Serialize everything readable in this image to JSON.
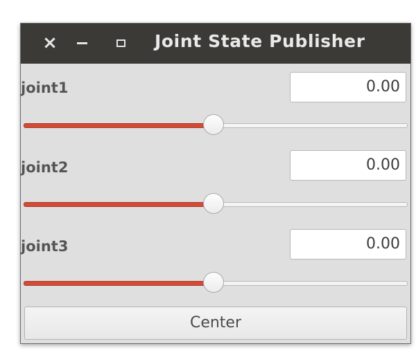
{
  "window": {
    "title": "Joint State Publisher",
    "buttons": {
      "close": "×",
      "minimize": "minimize",
      "maximize": "maximize"
    }
  },
  "joints": [
    {
      "name": "joint1",
      "value": "0.00",
      "slider_position": 0.5
    },
    {
      "name": "joint2",
      "value": "0.00",
      "slider_position": 0.5
    },
    {
      "name": "joint3",
      "value": "0.00",
      "slider_position": 0.5
    }
  ],
  "center_button": {
    "label": "Center"
  },
  "colors": {
    "titlebar": "#3b3a37",
    "slider_fill": "#d44a35",
    "window_bg": "#dfdfdf"
  }
}
